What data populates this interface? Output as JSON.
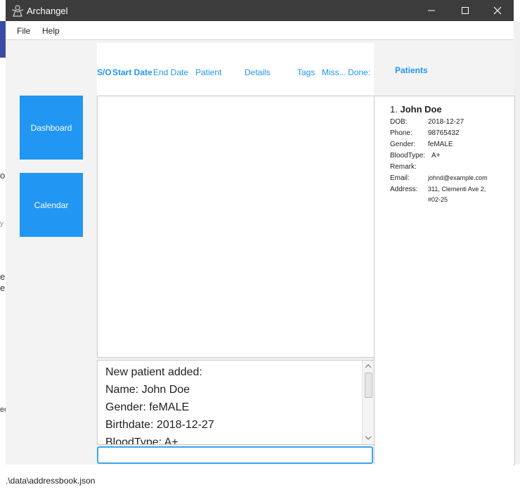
{
  "window": {
    "title": "Archangel"
  },
  "menu": {
    "items": [
      "File",
      "Help"
    ]
  },
  "sidebar": {
    "buttons": [
      "Dashboard",
      "Calendar"
    ]
  },
  "table": {
    "columns": [
      "S/O",
      "Start Date",
      "End Date",
      "Patient",
      "Details",
      "Tags",
      "Miss...",
      "Done:"
    ]
  },
  "patients": {
    "title": "Patients",
    "entries": [
      {
        "index": "1.",
        "name": "John Doe",
        "fields": [
          {
            "label": "DOB:",
            "value": "2018-12-27"
          },
          {
            "label": "Phone:",
            "value": "98765432"
          },
          {
            "label": "Gender:",
            "value": "feMALE"
          },
          {
            "label": "BloodType:",
            "value": "A+"
          },
          {
            "label": "Remark:",
            "value": ""
          },
          {
            "label": "Email:",
            "value": "johnd@example.com"
          },
          {
            "label": "Address:",
            "value": "311, Clementi Ave 2,"
          },
          {
            "label": "",
            "value": "#02-25"
          }
        ]
      }
    ]
  },
  "result": {
    "lines": [
      "New patient added:",
      "Name: John Doe",
      "Gender: feMALE",
      "Birthdate: 2018-12-27",
      "BloodType: A+"
    ]
  },
  "command": {
    "value": "",
    "placeholder": ""
  },
  "status": {
    "path": ".\\data\\addressbook.json"
  },
  "background": {
    "fragments": [
      "o",
      "y",
      "e",
      "er",
      "ec"
    ]
  },
  "colors": {
    "accent": "#2196f3",
    "titlebar": "#3c3c3c",
    "input_focus": "#39a7e8"
  }
}
